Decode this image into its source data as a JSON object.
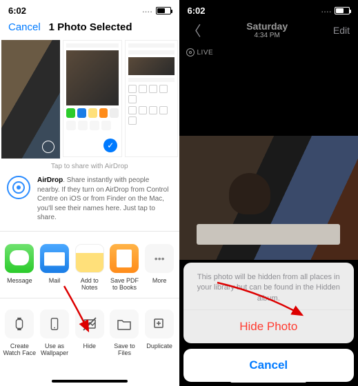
{
  "left": {
    "status": {
      "time": "6:02"
    },
    "nav": {
      "cancel": "Cancel",
      "title": "1 Photo Selected"
    },
    "hint": "Tap to share with AirDrop",
    "airdrop": {
      "bold": "AirDrop",
      "text": ". Share instantly with people nearby. If they turn on AirDrop from Control Centre on iOS or from Finder on the Mac, you'll see their names here. Just tap to share."
    },
    "share": {
      "messages": "Message",
      "mail": "Mail",
      "notes": "Add to Notes",
      "books": "Save PDF to Books",
      "more": "More"
    },
    "actions": {
      "watchface": "Create Watch Face",
      "wallpaper": "Use as Wallpaper",
      "hide": "Hide",
      "savefiles": "Save to Files",
      "duplicate": "Duplicate"
    }
  },
  "right": {
    "status": {
      "time": "6:02"
    },
    "nav": {
      "day": "Saturday",
      "time": "4:34 PM",
      "edit": "Edit"
    },
    "live_label": "LIVE",
    "sheet": {
      "message": "This photo will be hidden from all places in your library but can be found in the Hidden album.",
      "hide": "Hide Photo",
      "cancel": "Cancel"
    }
  }
}
